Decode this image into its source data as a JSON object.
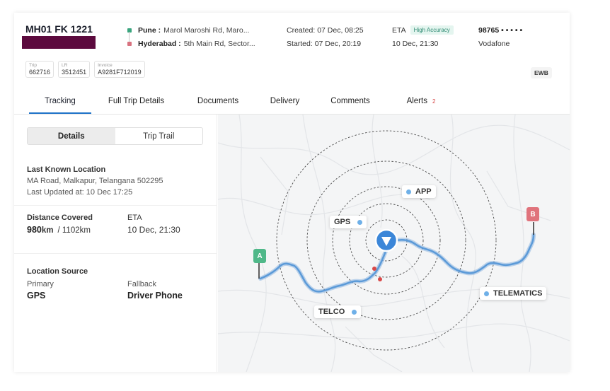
{
  "header": {
    "vehicle_number": "MH01 FK 1221",
    "origin_city": "Pune :",
    "origin_address": "Marol Maroshi Rd, Maro...",
    "destination_city": "Hyderabad :",
    "destination_address": "5th Main Rd, Sector...",
    "created": "Created: 07 Dec, 08:25",
    "started": "Started:  07 Dec, 20:19",
    "eta_label": "ETA",
    "eta_accuracy": "High Accuracy",
    "eta_value": "10 Dec, 21:30",
    "driver_number": "98765 • • • • •",
    "carrier": "Vodafone",
    "ewb": "EWB",
    "colors": {
      "origin": "#3aa57e",
      "destination": "#d8727f",
      "redaction": "#5c0a3e"
    }
  },
  "ids": [
    {
      "label": "Trip",
      "value": "662716"
    },
    {
      "label": "LR",
      "value": "3512451"
    },
    {
      "label": "Invoice",
      "value": "A9281F712019"
    }
  ],
  "tabs": [
    {
      "label": "Tracking",
      "active": true
    },
    {
      "label": "Full Trip Details"
    },
    {
      "label": "Documents"
    },
    {
      "label": "Delivery"
    },
    {
      "label": "Comments"
    },
    {
      "label": "Alerts",
      "count": "2"
    }
  ],
  "details": {
    "segment": [
      "Details",
      "Trip Trail"
    ],
    "last_known_title": "Last Known Location",
    "last_known_address": "MA Road, Malkapur, Telangana 502295",
    "last_updated": "Last Updated at: 10 Dec 17:25",
    "distance_title": "Distance Covered",
    "distance_value": "980",
    "distance_unit": "km",
    "distance_total": "/ 1102",
    "distance_total_unit": "km",
    "eta_title": "ETA",
    "eta_value": "10 Dec, 21:30",
    "source_title": "Location Source",
    "primary_label": "Primary",
    "primary_value": "GPS",
    "fallback_label": "Fallback",
    "fallback_value": "Driver Phone"
  },
  "map": {
    "start_pin": "A",
    "end_pin": "B",
    "sources": [
      "APP",
      "GPS",
      "TELCO",
      "TELEMATICS"
    ],
    "colors": {
      "route": "#5b9ad8",
      "start": "#4fb889",
      "end": "#e0737c",
      "marker": "#3b86d8"
    },
    "icons": [
      "navigation-arrow-icon"
    ]
  }
}
